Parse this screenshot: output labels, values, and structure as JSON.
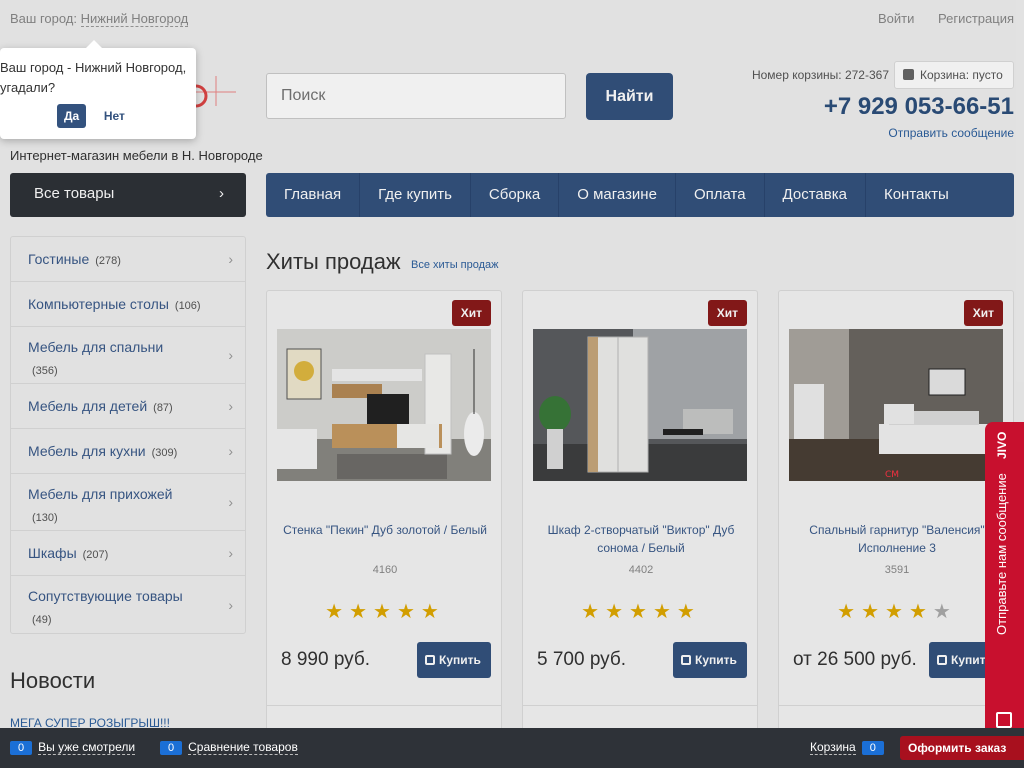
{
  "topbar": {
    "city_label": "Ваш город:",
    "city_value": "Нижний Новгород",
    "login": "Войти",
    "register": "Регистрация"
  },
  "header": {
    "search_placeholder": "Поиск",
    "search_button": "Найти",
    "cart_number": "Номер корзины: 272-367",
    "cart_status": "Корзина: пусто",
    "phone": "+7 929 053-66-51",
    "send_message": "Отправить сообщение",
    "tagline": "Интернет-магазин мебели в Н. Новгороде"
  },
  "city_popup": {
    "line1": "Ваш город - Нижний Новгород,",
    "line2": "угадали?",
    "yes": "Да",
    "no": "Нет"
  },
  "nav": {
    "all_goods": "Все товары",
    "items": [
      "Главная",
      "Где купить",
      "Сборка",
      "О магазине",
      "Оплата",
      "Доставка",
      "Контакты"
    ]
  },
  "categories": [
    {
      "label": "Гостиные",
      "count": "(278)"
    },
    {
      "label": "Компьютерные столы",
      "count": "(106)"
    },
    {
      "label": "Мебель для спальни",
      "count": "(356)"
    },
    {
      "label": "Мебель для детей",
      "count": "(87)"
    },
    {
      "label": "Мебель для кухни",
      "count": "(309)"
    },
    {
      "label": "Мебель для прихожей",
      "count": "(130)"
    },
    {
      "label": "Шкафы",
      "count": "(207)"
    },
    {
      "label": "Сопутствующие товары",
      "count": "(49)"
    }
  ],
  "news": {
    "heading": "Новости",
    "first_link": "МЕГА СУПЕР РОЗЫГРЫШ!!!"
  },
  "hits": {
    "heading": "Хиты продаж",
    "all_link": "Все хиты продаж",
    "products": [
      {
        "badge": "Хит",
        "title": "Стенка \"Пекин\" Дуб золотой / Белый",
        "code": "4160",
        "rating": 5,
        "price": "8 990 руб.",
        "buy": "Купить"
      },
      {
        "badge": "Хит",
        "title": "Шкаф 2-створчатый \"Виктор\" Дуб сонома / Белый",
        "code": "4402",
        "rating": 5,
        "price": "5 700 руб.",
        "buy": "Купить"
      },
      {
        "badge": "Хит",
        "title": "Спальный гарнитур \"Валенсия\" Исполнение 3",
        "code": "3591",
        "rating": 4,
        "price": "от 26 500 руб.",
        "buy": "Купить"
      }
    ]
  },
  "jivo": {
    "label": "Отправьте нам сообщение",
    "brand": "JIVO"
  },
  "bottombar": {
    "viewed_count": "0",
    "viewed_label": "Вы уже смотрели",
    "compare_count": "0",
    "compare_label": "Сравнение товаров",
    "cart_label": "Корзина",
    "cart_count": "0",
    "order_button": "Оформить заказ"
  }
}
